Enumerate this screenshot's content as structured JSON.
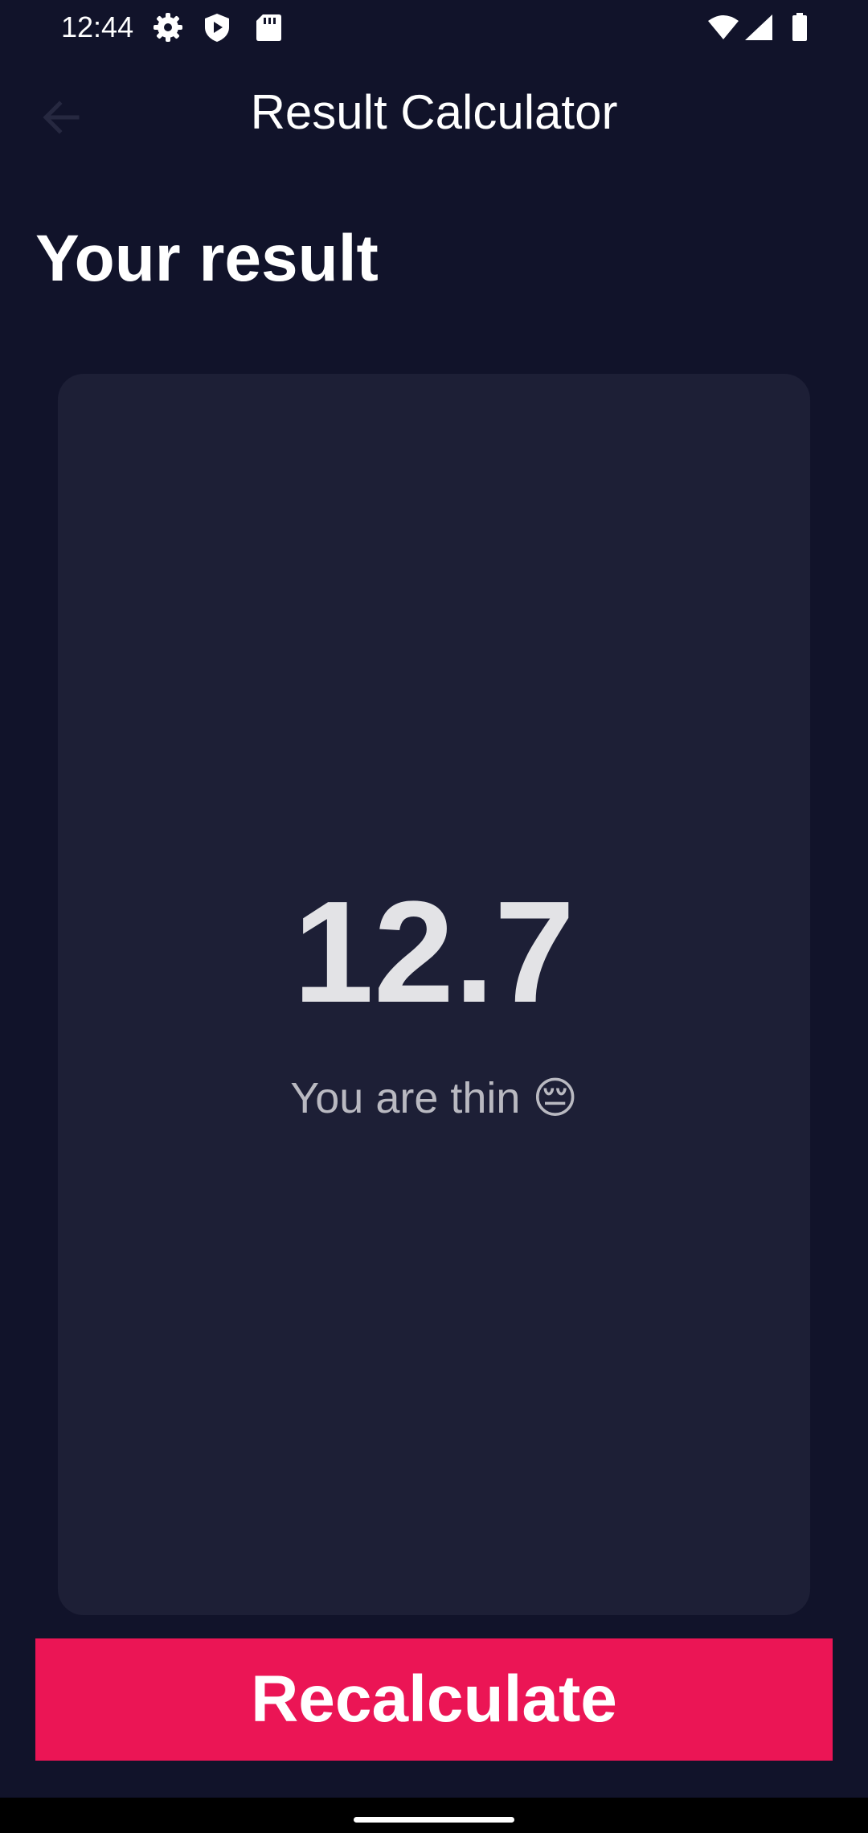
{
  "status_bar": {
    "time": "12:44",
    "left_icons": [
      "gear-icon",
      "shield-play-icon",
      "sd-card-icon"
    ],
    "right_icons": [
      "wifi-icon",
      "cell-signal-icon",
      "battery-icon"
    ]
  },
  "app_bar": {
    "title": "Result Calculator",
    "back_icon": "arrow-back-icon"
  },
  "main": {
    "section_title": "Your result",
    "result_value": "12.7",
    "result_text": "You are thin 😔"
  },
  "actions": {
    "recalculate_label": "Recalculate"
  },
  "colors": {
    "background": "#11132a",
    "card": "#1d1f36",
    "accent": "#eb1555"
  }
}
